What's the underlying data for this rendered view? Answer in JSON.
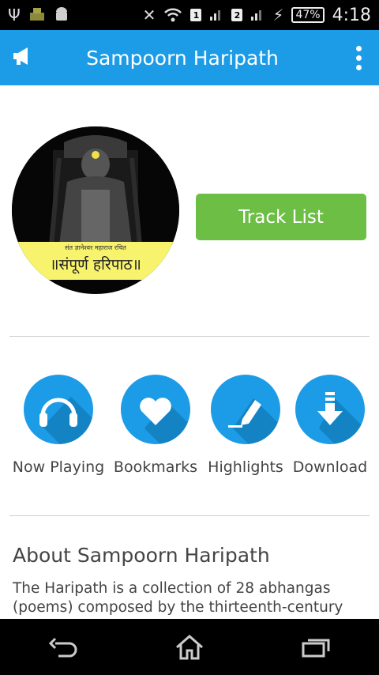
{
  "status_bar": {
    "sim1": "1",
    "sim2": "2",
    "battery": "47%",
    "time": "4:18"
  },
  "app_bar": {
    "title": "Sampoorn Haripath",
    "icons": [
      "megaphone-icon",
      "overflow-menu-icon"
    ]
  },
  "cover": {
    "subtitle": "संत ज्ञानेश्वर महाराज रचित",
    "title": "॥संपूर्ण हरिपाठ॥"
  },
  "track_list_label": "Track List",
  "actions": [
    {
      "label": "Now Playing",
      "icon": "headphones-icon"
    },
    {
      "label": "Bookmarks",
      "icon": "heart-icon"
    },
    {
      "label": "Highlights",
      "icon": "highlighter-icon"
    },
    {
      "label": "Download",
      "icon": "download-icon"
    }
  ],
  "about": {
    "title": "About Sampoorn Haripath",
    "body": "The Haripath is a collection of 28 abhangas (poems) composed by the thirteenth-century"
  },
  "colors": {
    "primary": "#1c9be6",
    "accent_green": "#6cbe45",
    "banner_yellow": "#f7f36d"
  }
}
